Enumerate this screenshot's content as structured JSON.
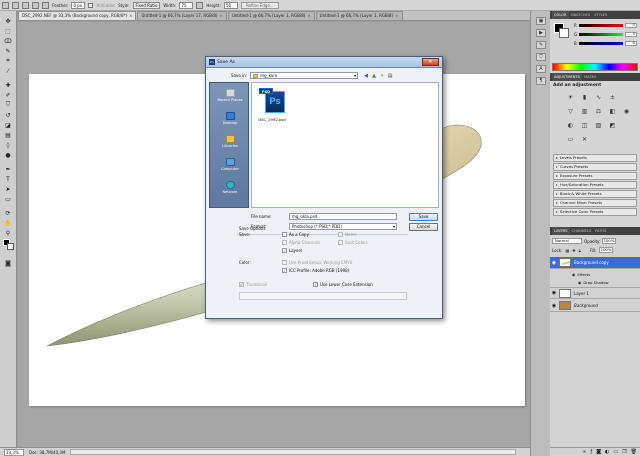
{
  "options_bar": {
    "feather_label": "Feather:",
    "feather_value": "0 px",
    "antialias_label": "Anti-alias",
    "style_label": "Style:",
    "style_value": "Fixed Ratio",
    "width_label": "Width:",
    "width_value": "75",
    "height_label": "Height:",
    "height_value": "50",
    "refine_edge_label": "Refine Edge..."
  },
  "document_tabs": [
    {
      "label": "DSC_2992.NEF @ 33,3% (Background copy, RGB/8*)",
      "active": true
    },
    {
      "label": "Untitled-1 @ 66,7% (Layer 17, RGB/8)"
    },
    {
      "label": "Untitled-1 @ 66,7% (Layer 1, RGB/8)"
    },
    {
      "label": "Untitled-1 @ 66,7% (Layer 1, RGB/8)"
    }
  ],
  "status_bar": {
    "zoom": "33,3%",
    "doc_info": "Doc: 38,7M/40,3M"
  },
  "panels": {
    "color_tabs": [
      "COLOR",
      "SWATCHES",
      "STYLES"
    ],
    "color_sliders": [
      {
        "label": "R",
        "value": "0",
        "gradient": "linear-gradient(90deg,#000,#f00)"
      },
      {
        "label": "G",
        "value": "0",
        "gradient": "linear-gradient(90deg,#000,#0f0)"
      },
      {
        "label": "B",
        "value": "0",
        "gradient": "linear-gradient(90deg,#000,#00f)"
      }
    ],
    "adjustments_tabs": [
      "ADJUSTMENTS",
      "MASKS"
    ],
    "adjustments_title": "Add an adjustment",
    "presets": [
      "Levels Presets",
      "Curves Presets",
      "Exposure Presets",
      "Hue/Saturation Presets",
      "Black & White Presets",
      "Channel Mixer Presets",
      "Selective Color Presets"
    ],
    "layers_tabs": [
      "LAYERS",
      "CHANNELS",
      "PATHS"
    ],
    "blend_mode": "Normal",
    "opacity_label": "Opacity:",
    "opacity_value": "100%",
    "lock_label": "Lock:",
    "fill_label": "Fill:",
    "fill_value": "100%",
    "layers": [
      {
        "name": "Background copy",
        "selected": true
      },
      {
        "name": "Layer 1"
      },
      {
        "name": "Background"
      }
    ],
    "effects_label": "Effects",
    "effect_item": "Drop Shadow"
  },
  "dialog": {
    "title": "Save As",
    "save_in_label": "Save in:",
    "save_in_value": "mg_kure",
    "places": [
      "Recent Places",
      "Desktop",
      "Libraries",
      "Computer",
      "Network"
    ],
    "file": {
      "tag": "PSD",
      "glyph": "Ps",
      "name": "DSC_2992.psd"
    },
    "file_name_label": "File name:",
    "file_name_value": "mg_okla.psd",
    "format_label": "Format:",
    "format_value": "Photoshop (*.PSD;*.PDD)",
    "save_button": "Save",
    "cancel_button": "Cancel",
    "save_options_label": "Save Options",
    "save_label": "Save:",
    "as_a_copy": "As a Copy",
    "notes": "Notes",
    "alpha_channels": "Alpha Channels",
    "spot_colors": "Spot Colors",
    "layers": "Layers",
    "color_label": "Color:",
    "use_proof_setup": "Use Proof Setup:  Working CMYK",
    "icc_profile": "ICC Profile:  Adobe RGB (1998)",
    "thumbnail": "Thumbnail",
    "use_lower_case": "Use Lower Case Extension"
  }
}
